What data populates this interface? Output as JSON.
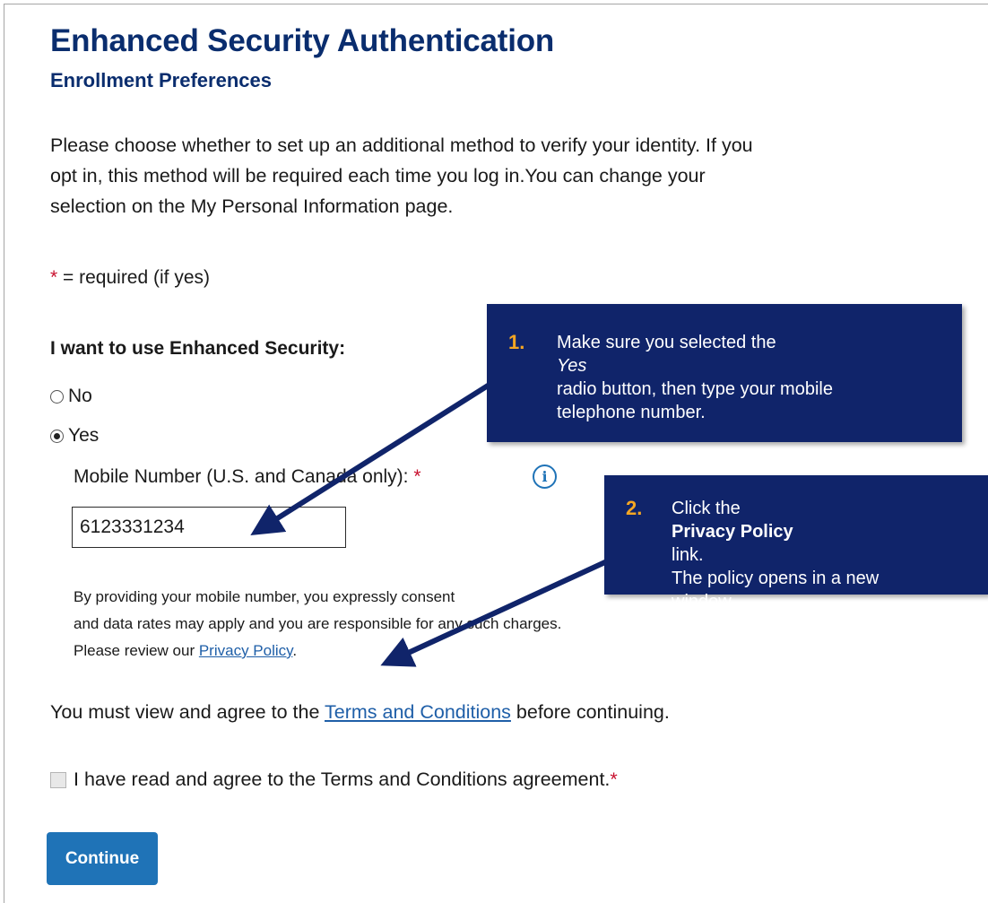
{
  "header": {
    "title": "Enhanced Security Authentication",
    "subtitle": "Enrollment Preferences"
  },
  "intro": {
    "line1": "Please choose whether to set up an additional method to verify your identity. If you",
    "line2": "opt in, this method will be required each time you log in.You can change your",
    "line3": "selection on the My Personal Information page."
  },
  "required_note": {
    "star": "*",
    "text": " = required (if yes)"
  },
  "question": "I want to use Enhanced Security:",
  "options": {
    "no_label": "No",
    "yes_label": "Yes",
    "selected": "Yes"
  },
  "mobile": {
    "label": "Mobile Number (U.S. and Canada only): ",
    "star": "*",
    "info_icon": "i",
    "value": "6123331234"
  },
  "consent": {
    "line1": "By providing your mobile number, you expressly consent",
    "line2": "and data rates may apply and you are responsible for any such charges.",
    "line3_prefix": "Please review our ",
    "privacy_link": "Privacy Policy",
    "line3_suffix": "."
  },
  "terms": {
    "prefix": "You must view and agree to the ",
    "link": "Terms and Conditions",
    "suffix": " before continuing."
  },
  "agree": {
    "label": "I have read and agree to the Terms and Conditions agreement. ",
    "star": "*",
    "checked": false
  },
  "continue_label": "Continue",
  "callouts": [
    {
      "number": "1.",
      "line1_prefix": "Make sure you selected the ",
      "line1_em": "Yes",
      "line2": "radio button, then type your mobile",
      "line3": "telephone number."
    },
    {
      "number": "2.",
      "line1_prefix": "Click the ",
      "line1_strong": "Privacy Policy",
      "line1_suffix": " link.",
      "line2": "The policy opens in a new",
      "line3": "window."
    }
  ],
  "colors": {
    "heading": "#0a2d6e",
    "required_star": "#c8102e",
    "link": "#1f5fa8",
    "button": "#1f73b7",
    "callout_bg": "#10246a",
    "callout_number": "#f5a623"
  }
}
